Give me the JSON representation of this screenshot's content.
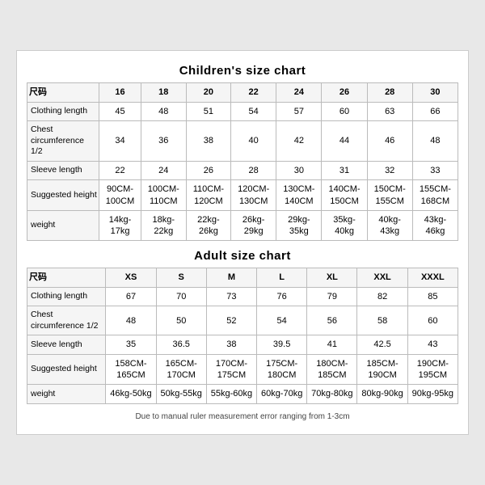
{
  "children": {
    "title": "Children's size chart",
    "columns": [
      "尺码",
      "16",
      "18",
      "20",
      "22",
      "24",
      "26",
      "28",
      "30"
    ],
    "rows": [
      {
        "label": "Clothing length",
        "values": [
          "45",
          "48",
          "51",
          "54",
          "57",
          "60",
          "63",
          "66"
        ]
      },
      {
        "label": "Chest circumference 1/2",
        "values": [
          "34",
          "36",
          "38",
          "40",
          "42",
          "44",
          "46",
          "48"
        ]
      },
      {
        "label": "Sleeve length",
        "values": [
          "22",
          "24",
          "26",
          "28",
          "30",
          "31",
          "32",
          "33"
        ]
      },
      {
        "label": "Suggested height",
        "values": [
          "90CM-100CM",
          "100CM-110CM",
          "110CM-120CM",
          "120CM-130CM",
          "130CM-140CM",
          "140CM-150CM",
          "150CM-155CM",
          "155CM-168CM"
        ]
      },
      {
        "label": "weight",
        "values": [
          "14kg-17kg",
          "18kg-22kg",
          "22kg-26kg",
          "26kg-29kg",
          "29kg-35kg",
          "35kg-40kg",
          "40kg-43kg",
          "43kg-46kg"
        ]
      }
    ]
  },
  "adult": {
    "title": "Adult size chart",
    "columns": [
      "尺码",
      "XS",
      "S",
      "M",
      "L",
      "XL",
      "XXL",
      "XXXL"
    ],
    "rows": [
      {
        "label": "Clothing length",
        "values": [
          "67",
          "70",
          "73",
          "76",
          "79",
          "82",
          "85"
        ]
      },
      {
        "label": "Chest circumference 1/2",
        "values": [
          "48",
          "50",
          "52",
          "54",
          "56",
          "58",
          "60"
        ]
      },
      {
        "label": "Sleeve length",
        "values": [
          "35",
          "36.5",
          "38",
          "39.5",
          "41",
          "42.5",
          "43"
        ]
      },
      {
        "label": "Suggested height",
        "values": [
          "158CM-165CM",
          "165CM-170CM",
          "170CM-175CM",
          "175CM-180CM",
          "180CM-185CM",
          "185CM-190CM",
          "190CM-195CM"
        ]
      },
      {
        "label": "weight",
        "values": [
          "46kg-50kg",
          "50kg-55kg",
          "55kg-60kg",
          "60kg-70kg",
          "70kg-80kg",
          "80kg-90kg",
          "90kg-95kg"
        ]
      }
    ]
  },
  "note": "Due to manual ruler measurement error ranging from 1-3cm"
}
